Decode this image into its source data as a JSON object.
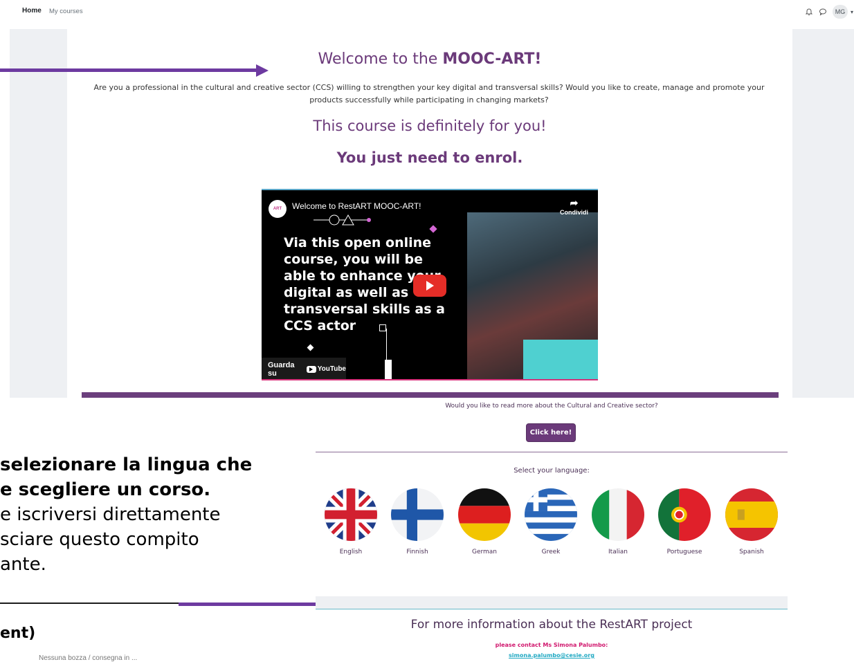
{
  "nav": {
    "home": "Home",
    "my_courses": "My courses",
    "user_initials": "MG"
  },
  "hero": {
    "welcome_prefix": "Welcome to the ",
    "welcome_brand": "MOOC-ART!",
    "intro": "Are you a professional in the cultural and creative sector (CCS) willing to strengthen your key digital and transversal skills? Would you like to create, manage and promote your products successfully while participating in changing markets?",
    "for_you": "This course is definitely for you!",
    "enrol": "You just need to enrol."
  },
  "video": {
    "channel_logo": "ART",
    "title": "Welcome to RestART MOOC-ART!",
    "share_label": "Condividi",
    "overlay_text": "Via this open online course, you will be able to enhance your digital as well as transversal skills as a CCS actor",
    "watch_on": "Guarda su",
    "youtube": "YouTube"
  },
  "lower": {
    "read_more": "Would you like to read more about the Cultural and Creative sector?",
    "click_here": "Click here!",
    "select_language": "Select your language:",
    "languages": [
      {
        "label": "English"
      },
      {
        "label": "Finnish"
      },
      {
        "label": "German"
      },
      {
        "label": "Greek"
      },
      {
        "label": "Italian"
      },
      {
        "label": "Portuguese"
      },
      {
        "label": "Spanish"
      }
    ],
    "more_info": "For more information about the RestART project",
    "contact": "please contact Ms Simona Palumbo:",
    "email": "simona.palumbo@cesie.org"
  },
  "overlay": {
    "line1": " selezionare la lingua che",
    "line2": "e scegliere un corso.",
    "line3": "e iscriversi direttamente",
    "line4": "sciare questo compito",
    "line5": "ante.",
    "ent": "ent)",
    "cutoff": "Nessuna bozza / consegna in ..."
  },
  "colors": {
    "accent": "#6b3a7a",
    "annotation": "#6d3aa0",
    "link": "#21a9c3",
    "contact": "#d1186e"
  }
}
